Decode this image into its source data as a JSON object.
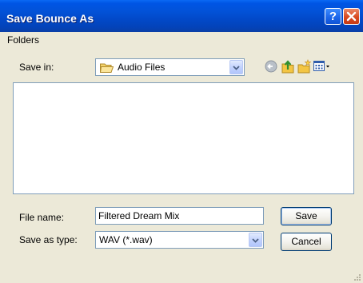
{
  "window": {
    "title": "Save Bounce As",
    "help_label": "?"
  },
  "menu": {
    "folders_label": "Folders"
  },
  "save_in": {
    "label": "Save in:",
    "value": "Audio Files"
  },
  "file_name": {
    "label": "File name:",
    "value": "Filtered Dream Mix"
  },
  "save_as_type": {
    "label": "Save as type:",
    "value": "WAV (*.wav)"
  },
  "buttons": {
    "save_label": "Save",
    "cancel_label": "Cancel"
  },
  "icons": {
    "back": "back-arrow-icon",
    "up": "up-folder-icon",
    "new_folder": "new-folder-icon",
    "views": "views-menu-icon"
  },
  "colors": {
    "titlebar": "#0252d8",
    "dialog_bg": "#ece9d8",
    "border": "#7f9db9"
  }
}
